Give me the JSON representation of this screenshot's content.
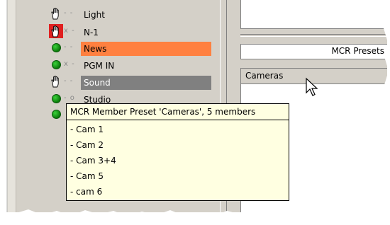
{
  "tree": {
    "items": [
      {
        "label": "Light",
        "icon": "hand-icon",
        "connector": "- -",
        "style": "normal"
      },
      {
        "label": "N-1",
        "icon": "hand-icon-red",
        "connector": "x -",
        "style": "normal"
      },
      {
        "label": "News",
        "icon": "green-dot-icon",
        "connector": "- -",
        "style": "orange"
      },
      {
        "label": "PGM IN",
        "icon": "green-dot-icon",
        "connector": "x -",
        "style": "normal"
      },
      {
        "label": "Sound",
        "icon": "hand-icon",
        "connector": "- -",
        "style": "gray"
      },
      {
        "label": "Studio",
        "icon": "green-dot-icon",
        "connector": "- o",
        "style": "normal"
      }
    ]
  },
  "right_panel": {
    "preset_field": "MCR Presets",
    "list_header": "Cameras"
  },
  "tooltip": {
    "title": "MCR Member Preset 'Cameras', 5 members",
    "items": [
      "- Cam 1",
      "- Cam 2",
      "- Cam 3+4",
      "- Cam 5",
      "- cam 6"
    ]
  },
  "colors": {
    "highlight_orange": "#ff8040",
    "highlight_gray": "#808080",
    "tooltip_bg": "#ffffe1"
  }
}
